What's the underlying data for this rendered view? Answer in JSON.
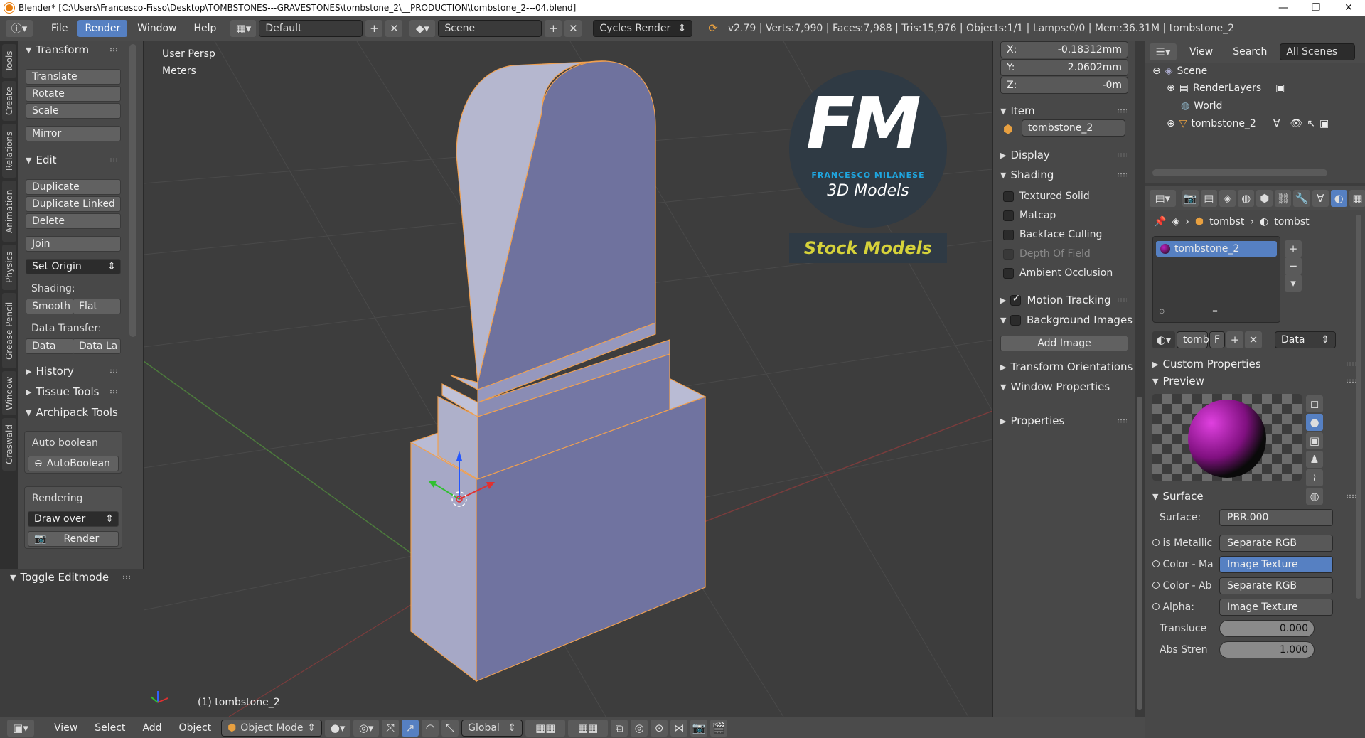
{
  "window": {
    "title": "Blender* [C:\\Users\\Francesco-Fisso\\Desktop\\TOMBSTONES---GRAVESTONES\\tombstone_2\\__PRODUCTION\\tombstone_2---04.blend]",
    "controls": {
      "minimize": "—",
      "maximize": "❐",
      "close": "✕"
    }
  },
  "topbar": {
    "menus": [
      "File",
      "Render",
      "Window",
      "Help"
    ],
    "active_menu": "Render",
    "layout": "Default",
    "scene": "Scene",
    "engine": "Cycles Render",
    "stats": "v2.79 | Verts:7,990 | Faces:7,988 | Tris:15,976 | Objects:1/1 | Lamps:0/0 | Mem:36.31M | tombstone_2"
  },
  "left_tabs": [
    "Tools",
    "Create",
    "Relations",
    "Animation",
    "Physics",
    "Grease Pencil",
    "Window",
    "Graswald"
  ],
  "toolshelf": {
    "transform": {
      "title": "Transform",
      "buttons": [
        "Translate",
        "Rotate",
        "Scale",
        "Mirror"
      ]
    },
    "edit": {
      "title": "Edit",
      "buttons": [
        "Duplicate",
        "Duplicate Linked",
        "Delete",
        "Join"
      ],
      "set_origin": "Set Origin",
      "shading_label": "Shading:",
      "smooth": "Smooth",
      "flat": "Flat",
      "data_transfer_label": "Data Transfer:",
      "data": "Data",
      "data_la": "Data La"
    },
    "history": "History",
    "tissue": "Tissue Tools",
    "archipack": "Archipack Tools",
    "auto_boolean_label": "Auto boolean",
    "auto_boolean_btn": "AutoBoolean",
    "rendering_label": "Rendering",
    "draw_over": "Draw over",
    "render_btn": "Render",
    "toggle_editmode": "Toggle Editmode"
  },
  "viewport": {
    "view_name": "User Persp",
    "units": "Meters",
    "object_label": "(1) tombstone_2",
    "logo_letters": "FM",
    "logo_name": "FRANCESCO MILANESE",
    "logo_sub": "3D Models",
    "logo_stock": "Stock Models"
  },
  "npanel": {
    "x_label": "X:",
    "x_value": "-0.18312mm",
    "y_label": "Y:",
    "y_value": "2.0602mm",
    "z_label": "Z:",
    "z_value": "-0m",
    "item_title": "Item",
    "item_name": "tombstone_2",
    "display": "Display",
    "shading": "Shading",
    "shading_options": [
      {
        "label": "Textured Solid",
        "checked": false,
        "enabled": true
      },
      {
        "label": "Matcap",
        "checked": false,
        "enabled": true
      },
      {
        "label": "Backface Culling",
        "checked": false,
        "enabled": true
      },
      {
        "label": "Depth Of Field",
        "checked": false,
        "enabled": false
      },
      {
        "label": "Ambient Occlusion",
        "checked": false,
        "enabled": true
      }
    ],
    "motion_tracking": "Motion Tracking",
    "background_images": "Background Images",
    "add_image": "Add Image",
    "transform_orientations": "Transform Orientations",
    "window_properties": "Window Properties",
    "properties": "Properties"
  },
  "outliner": {
    "view": "View",
    "search": "Search",
    "all_scenes": "All Scenes",
    "items": [
      {
        "label": "Scene",
        "icon": "scene-icon"
      },
      {
        "label": "RenderLayers",
        "icon": "renderlayers-icon"
      },
      {
        "label": "World",
        "icon": "world-icon"
      },
      {
        "label": "tombstone_2",
        "icon": "mesh-icon"
      }
    ]
  },
  "properties": {
    "breadcrumb": [
      "tombst",
      "tombst"
    ],
    "material_slot": "tombstone_2",
    "mat_name": "tomb",
    "mat_f": "F",
    "data_select": "Data",
    "custom_properties": "Custom Properties",
    "preview": "Preview",
    "surface_title": "Surface",
    "surface_label": "Surface:",
    "surface_value": "PBR.000",
    "inputs": [
      {
        "label": "is Metallic",
        "value": "Separate RGB",
        "highlight": false
      },
      {
        "label": "Color - Ma",
        "value": "Image Texture",
        "highlight": true
      },
      {
        "label": "Color - Ab",
        "value": "Separate RGB",
        "highlight": false
      },
      {
        "label": "Alpha:",
        "value": "Image Texture",
        "highlight": false
      }
    ],
    "transluce_label": "Transluce",
    "transluce_value": "0.000",
    "abs_stren_label": "Abs Stren",
    "abs_stren_value": "1.000"
  },
  "bottombar": {
    "menus": [
      "View",
      "Select",
      "Add",
      "Object"
    ],
    "mode": "Object Mode",
    "orientation": "Global"
  },
  "colors": {
    "accent": "#5680c2",
    "selection_outline": "#f0a050",
    "logo_blue": "#1fa6e0",
    "logo_yellow": "#d6d23a"
  }
}
